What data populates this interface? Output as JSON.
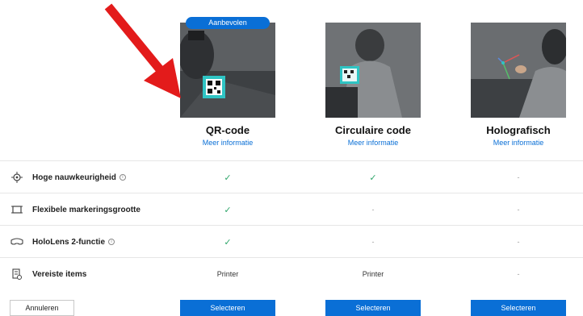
{
  "recommended_badge": "Aanbevolen",
  "options": [
    {
      "title": "QR-code",
      "link": "Meer informatie",
      "select": "Selecteren"
    },
    {
      "title": "Circulaire code",
      "link": "Meer informatie",
      "select": "Selecteren"
    },
    {
      "title": "Holografisch",
      "link": "Meer informatie",
      "select": "Selecteren"
    }
  ],
  "rows": [
    {
      "label": "Hoge nauwkeurigheid",
      "info": "i",
      "icon": "target-icon",
      "values": [
        "✓",
        "✓",
        "-"
      ]
    },
    {
      "label": "Flexibele markeringsgrootte",
      "info": "",
      "icon": "resize-icon",
      "values": [
        "✓",
        "-",
        "-"
      ]
    },
    {
      "label": "HoloLens 2-functie",
      "info": "i",
      "icon": "headset-icon",
      "values": [
        "✓",
        "-",
        "-"
      ]
    },
    {
      "label": "Vereiste items",
      "info": "",
      "icon": "checklist-icon",
      "values": [
        "Printer",
        "Printer",
        "-"
      ]
    }
  ],
  "cancel_label": "Annuleren",
  "colors": {
    "accent": "#0a6fd6",
    "check": "#2fa66b",
    "arrow": "#e31b1b"
  }
}
